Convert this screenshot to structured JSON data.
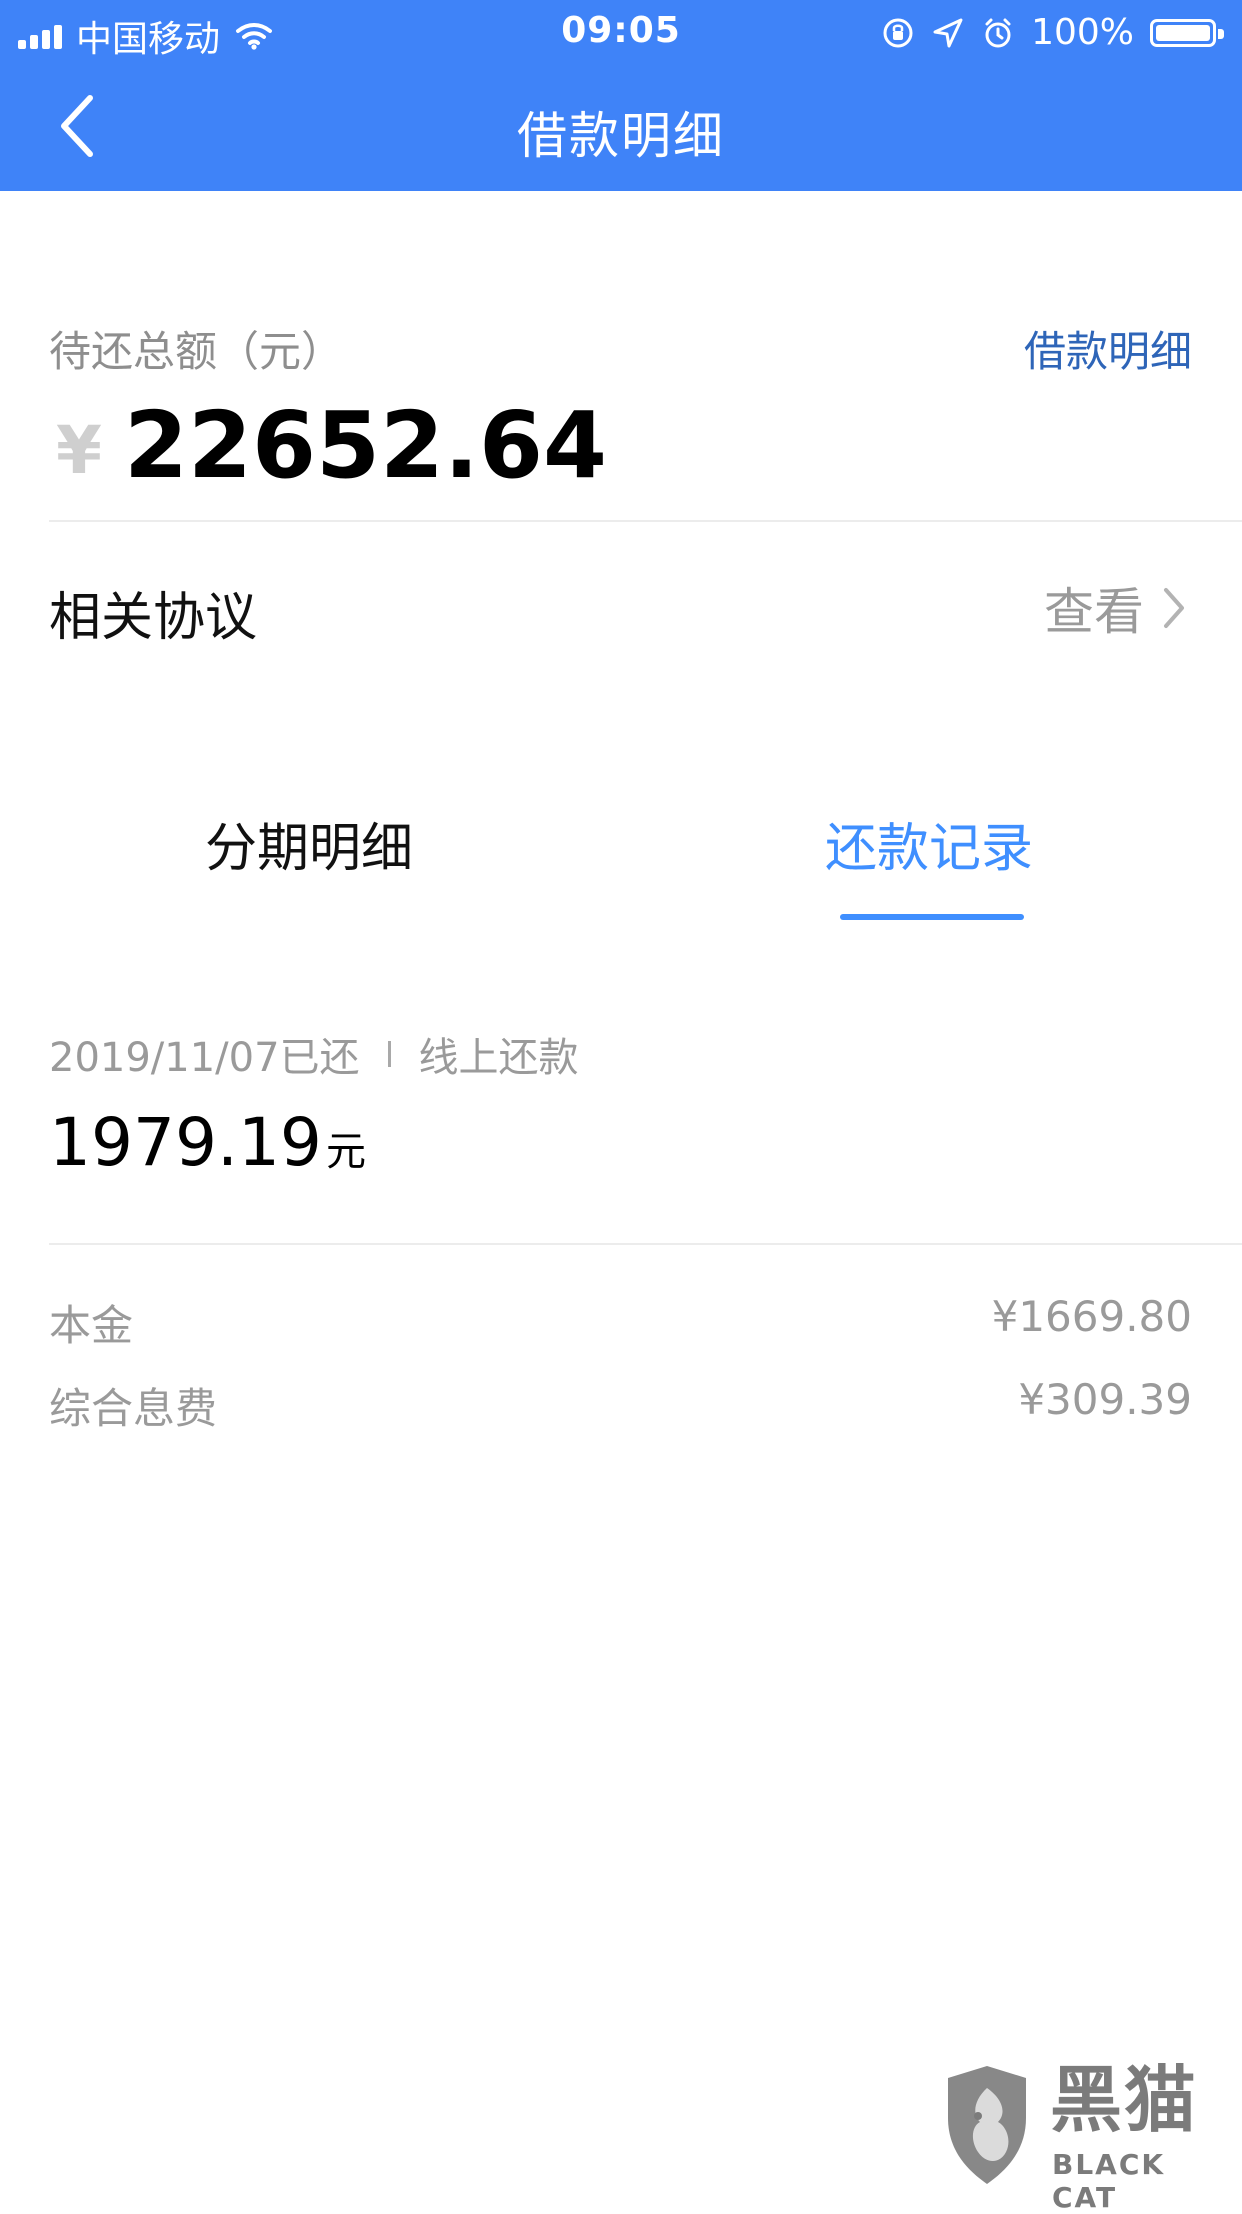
{
  "status_bar": {
    "carrier": "中国移动",
    "time": "09:05",
    "battery_percent": "100%",
    "icons": [
      "signal-icon",
      "wifi-icon",
      "orientation-lock-icon",
      "location-icon",
      "alarm-icon",
      "battery-icon"
    ]
  },
  "nav": {
    "title": "借款明细",
    "back_icon": "back-chevron-icon"
  },
  "summary": {
    "label": "待还总额（元）",
    "link": "借款明细",
    "currency": "¥",
    "amount": "22652.64"
  },
  "agreements": {
    "label": "相关协议",
    "action": "查看",
    "chevron_icon": "chevron-right-icon"
  },
  "tabs": [
    {
      "label": "分期明细",
      "active": false
    },
    {
      "label": "还款记录",
      "active": true
    }
  ],
  "record": {
    "date_status": "2019/11/07已还",
    "method": "线上还款",
    "amount": "1979.19",
    "unit": "元",
    "details": [
      {
        "label": "本金",
        "value": "¥1669.80"
      },
      {
        "label": "综合息费",
        "value": "¥309.39"
      }
    ]
  },
  "watermark": {
    "logo_icon": "black-cat-logo-icon",
    "text": "黑猫",
    "sub": "BLACK CAT"
  },
  "colors": {
    "header_blue": "#3f83f8",
    "tab_active": "#3f8fff",
    "link_blue": "#2e65b8",
    "text_gray": "#9a9a9a"
  }
}
